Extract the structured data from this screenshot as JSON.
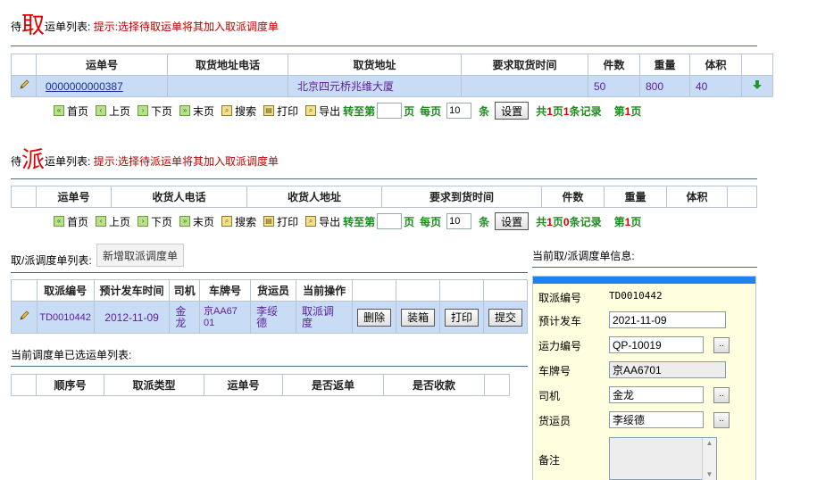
{
  "pickup": {
    "prefix": "待",
    "big": "取",
    "title_suffix": "运单列表:",
    "hint": "提示:选择待取运单将其加入取派调度单",
    "columns": [
      "运单号",
      "取货地址电话",
      "取货地址",
      "要求取货时间",
      "件数",
      "重量",
      "体积"
    ],
    "row": {
      "waybill": "0000000000387",
      "phone": "",
      "address": "北京四元桥兆维大厦",
      "time": "",
      "count": "50",
      "weight": "800",
      "volume": "40"
    }
  },
  "pager": {
    "first": "首页",
    "prev": "上页",
    "next": "下页",
    "last": "末页",
    "search": "搜索",
    "print": "打印",
    "export": "导出",
    "goto_prefix": "转至第",
    "page_unit": "页",
    "per_page": "每页",
    "per_page_value": "10",
    "item_unit": "条",
    "set_button": "设置",
    "total_a": "共",
    "total_b": "页",
    "total_c": "条记录",
    "page_prefix": "第",
    "page_suffix": "页"
  },
  "pickup_pager": {
    "pages": "1",
    "records": "1",
    "current": "1"
  },
  "delivery": {
    "prefix": "待",
    "big": "派",
    "title_suffix": "运单列表:",
    "hint": "提示:选择待派运单将其加入取派调度单",
    "columns": [
      "运单号",
      "收货人电话",
      "收货人地址",
      "要求到货时间",
      "件数",
      "重量",
      "体积"
    ]
  },
  "delivery_pager": {
    "pages": "1",
    "records": "0",
    "current": "1"
  },
  "dispatch": {
    "title": "取/派调度单列表:",
    "new_button": "新增取派调度单",
    "columns": [
      "取派编号",
      "预计发车时间",
      "司机",
      "车牌号",
      "货运员",
      "当前操作"
    ],
    "row": {
      "id": "TD0010442",
      "time": "2012-11-09",
      "driver": "金龙",
      "plate": "京AA6701",
      "clerk": "李绥德",
      "op": "取派调度"
    },
    "actions": [
      "删除",
      "装箱",
      "打印",
      "提交"
    ]
  },
  "selected": {
    "title": "当前调度单已选运单列表:",
    "columns": [
      "顺序号",
      "取派类型",
      "运单号",
      "是否返单",
      "是否收款"
    ]
  },
  "info": {
    "title": "当前取/派调度单信息:",
    "id_label": "取派编号",
    "id_value": "TD0010442",
    "depart_label": "预计发车",
    "depart_value": "2021-11-09",
    "capacity_label": "运力编号",
    "capacity_value": "QP-10019",
    "plate_label": "车牌号",
    "plate_value": "京AA6701",
    "driver_label": "司机",
    "driver_value": "金龙",
    "clerk_label": "货运员",
    "clerk_value": "李绥德",
    "remark_label": "备注",
    "remark_value": "",
    "dots": ".."
  }
}
